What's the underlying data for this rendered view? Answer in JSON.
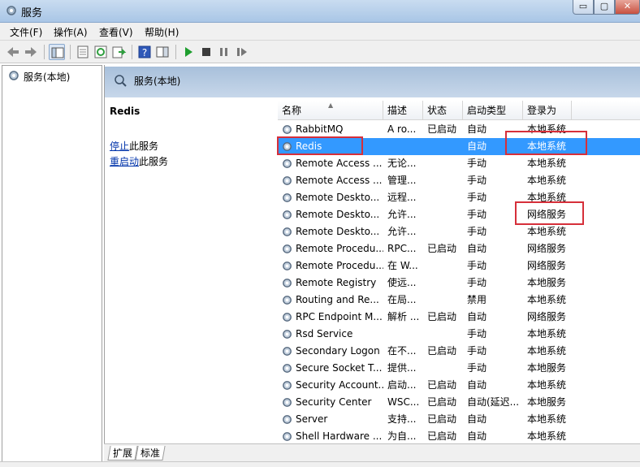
{
  "window": {
    "title": "服务"
  },
  "menu": {
    "items": [
      "文件(F)",
      "操作(A)",
      "查看(V)",
      "帮助(H)"
    ]
  },
  "window_buttons": {
    "minimize": "▭",
    "maximize": "▢",
    "close": "✕"
  },
  "tree": {
    "item": "服务(本地)"
  },
  "pane": {
    "header": "服务(本地)"
  },
  "details": {
    "service_name": "Redis",
    "stop_link": "停止",
    "stop_suffix": "此服务",
    "restart_link": "重启动",
    "restart_suffix": "此服务"
  },
  "columns": [
    "名称",
    "描述",
    "状态",
    "启动类型",
    "登录为"
  ],
  "services": [
    {
      "name": "RabbitMQ",
      "desc": "A ro...",
      "status": "已启动",
      "startup": "自动",
      "logon": "本地系统"
    },
    {
      "name": "Redis",
      "desc": "",
      "status": "",
      "startup": "自动",
      "logon": "本地系统"
    },
    {
      "name": "Remote Access ...",
      "desc": "无论...",
      "status": "",
      "startup": "手动",
      "logon": "本地系统"
    },
    {
      "name": "Remote Access ...",
      "desc": "管理...",
      "status": "",
      "startup": "手动",
      "logon": "本地系统"
    },
    {
      "name": "Remote Deskto...",
      "desc": "远程...",
      "status": "",
      "startup": "手动",
      "logon": "本地系统"
    },
    {
      "name": "Remote Deskto...",
      "desc": "允许...",
      "status": "",
      "startup": "手动",
      "logon": "网络服务"
    },
    {
      "name": "Remote Deskto...",
      "desc": "允许...",
      "status": "",
      "startup": "手动",
      "logon": "本地系统"
    },
    {
      "name": "Remote Procedu...",
      "desc": "RPC...",
      "status": "已启动",
      "startup": "自动",
      "logon": "网络服务"
    },
    {
      "name": "Remote Procedu...",
      "desc": "在 W...",
      "status": "",
      "startup": "手动",
      "logon": "网络服务"
    },
    {
      "name": "Remote Registry",
      "desc": "使远...",
      "status": "",
      "startup": "手动",
      "logon": "本地服务"
    },
    {
      "name": "Routing and Re...",
      "desc": "在局...",
      "status": "",
      "startup": "禁用",
      "logon": "本地系统"
    },
    {
      "name": "RPC Endpoint M...",
      "desc": "解析 ...",
      "status": "已启动",
      "startup": "自动",
      "logon": "网络服务"
    },
    {
      "name": "Rsd Service",
      "desc": "",
      "status": "",
      "startup": "手动",
      "logon": "本地系统"
    },
    {
      "name": "Secondary Logon",
      "desc": "在不...",
      "status": "已启动",
      "startup": "手动",
      "logon": "本地系统"
    },
    {
      "name": "Secure Socket T...",
      "desc": "提供...",
      "status": "",
      "startup": "手动",
      "logon": "本地服务"
    },
    {
      "name": "Security Account...",
      "desc": "启动...",
      "status": "已启动",
      "startup": "自动",
      "logon": "本地系统"
    },
    {
      "name": "Security Center",
      "desc": "WSC...",
      "status": "已启动",
      "startup": "自动(延迟...",
      "logon": "本地服务"
    },
    {
      "name": "Server",
      "desc": "支持...",
      "status": "已启动",
      "startup": "自动",
      "logon": "本地系统"
    },
    {
      "name": "Shell Hardware ...",
      "desc": "为自...",
      "status": "已启动",
      "startup": "自动",
      "logon": "本地系统"
    }
  ],
  "selected_index": 1,
  "tabs": [
    "扩展",
    "标准"
  ],
  "colors": {
    "selection": "#3399ff",
    "highlight_box": "#d62f3a",
    "link": "#0033aa"
  }
}
